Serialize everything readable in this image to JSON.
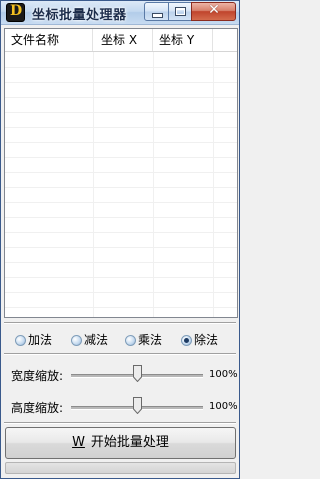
{
  "window": {
    "title": "坐标批量处理器",
    "icon_letter": "D",
    "icons": {
      "app": "app-icon",
      "minimize": "minimize-icon",
      "maximize": "maximize-icon",
      "close": "close-icon"
    },
    "colors": {
      "close_button": "#c0442c",
      "accent": "#1c3a62"
    }
  },
  "table": {
    "columns": [
      "文件名称",
      "坐标 X",
      "坐标 Y"
    ],
    "rows": []
  },
  "operations": {
    "options": [
      {
        "label": "加法",
        "checked": false
      },
      {
        "label": "减法",
        "checked": false
      },
      {
        "label": "乘法",
        "checked": false
      },
      {
        "label": "除法",
        "checked": true
      }
    ]
  },
  "width_scale": {
    "label": "宽度缩放:",
    "value": "100%",
    "level": 0.5
  },
  "height_scale": {
    "label": "高度缩放:",
    "value": "100%",
    "level": 0.5
  },
  "action": {
    "hotkey": "W",
    "label": "开始批量处理"
  }
}
